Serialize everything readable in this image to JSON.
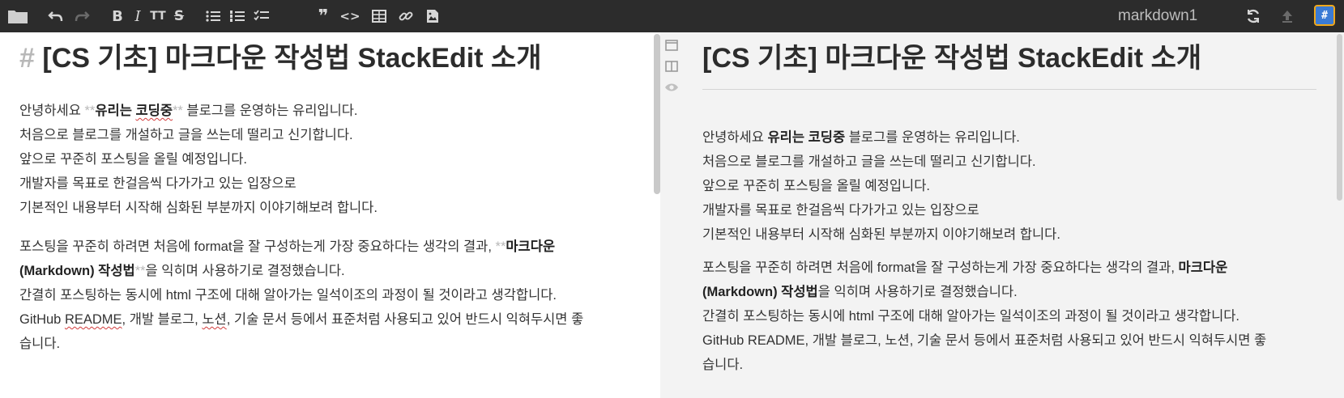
{
  "toolbar": {
    "icons": [
      "folder-icon",
      "undo-icon",
      "redo-icon",
      "bold-icon",
      "italic-icon",
      "heading-icon",
      "strikethrough-icon",
      "unordered-list-icon",
      "ordered-list-icon",
      "checklist-icon",
      "blockquote-icon",
      "code-icon",
      "table-icon",
      "link-icon",
      "image-icon",
      "sync-icon",
      "publish-icon",
      "workspace-icon"
    ],
    "bold_glyph": "B",
    "italic_glyph": "I",
    "heading_glyph": "TT",
    "strike_glyph": "S",
    "quote_glyph": "❞",
    "code_glyph": "<>",
    "document_title": "markdown1",
    "workspace_glyph": "#"
  },
  "editor": {
    "heading_mark": "#",
    "heading_text": "[CS 기초] 마크다운 작성법 StackEdit 소개",
    "p1": {
      "l1_before": "안녕하세요 ",
      "l1_mark_open": "**",
      "l1_bold_a": "유리는 ",
      "l1_bold_b": "코딩중",
      "l1_mark_close": "**",
      "l1_after": " 블로그를 운영하는 유리입니다.",
      "l2": "처음으로 블로그를 개설하고 글을 쓰는데 떨리고 신기합니다.",
      "l3": "앞으로 꾸준히 포스팅을 올릴 예정입니다.",
      "l4": "개발자를 목표로 한걸음씩 다가가고 있는 입장으로",
      "l5": "기본적인 내용부터 시작해 심화된 부분까지 이야기해보려 합니다."
    },
    "p2": {
      "a_before": "포스팅을 꾸준히 하려면 처음에 format을 잘 구성하는게 가장 중요하다는 생각의 결과, ",
      "a_mark_open": "**",
      "a_bold1": "마크다운",
      "a_bold2": "(Markdown) 작성법",
      "a_mark_close": "**",
      "a_after": "을 익히며 사용하기로 결정했습니다.",
      "b": "간결히 포스팅하는 동시에 html 구조에 대해 알아가는 일석이조의  과정이 될 것이라고 생각합니다.",
      "c_1": "GitHub ",
      "c_readme": "README",
      "c_2": ", 개발 블로그, ",
      "c_notion": "노션",
      "c_3": ", 기술 문서 등에서 표준처럼 사용되고 있어 반드시 익혀두시면 좋",
      "c_4": "습니다."
    }
  },
  "side_tools": [
    "navigation-bar-toggle-icon",
    "side-preview-toggle-icon",
    "preview-eye-icon"
  ],
  "preview": {
    "heading": "[CS 기초] 마크다운 작성법 StackEdit 소개",
    "p1": {
      "l1_before": "안녕하세요 ",
      "l1_bold": "유리는 코딩중",
      "l1_after": " 블로그를 운영하는 유리입니다.",
      "l2": "처음으로 블로그를 개설하고 글을 쓰는데 떨리고 신기합니다.",
      "l3": "앞으로 꾸준히 포스팅을 올릴 예정입니다.",
      "l4": "개발자를 목표로 한걸음씩 다가가고 있는 입장으로",
      "l5": "기본적인 내용부터 시작해 심화된 부분까지 이야기해보려 합니다."
    },
    "p2": {
      "a_before": "포스팅을 꾸준히 하려면 처음에 format을 잘 구성하는게 가장 중요하다는 생각의 결과, ",
      "a_bold1": "마크다운",
      "a_bold2": "(Markdown) 작성법",
      "a_after": "을 익히며 사용하기로 결정했습니다.",
      "b": "간결히 포스팅하는 동시에 html 구조에 대해 알아가는 일석이조의 과정이 될 것이라고 생각합니다.",
      "c": "GitHub README, 개발 블로그, 노션, 기술 문서 등에서 표준처럼 사용되고 있어 반드시 익혀두시면 좋",
      "c_2": "습니다."
    }
  },
  "colors": {
    "toolbar_bg": "#2c2c2c",
    "preview_bg": "#f3f3f3",
    "markdown_marker": "#b8b8b8",
    "spellcheck": "#d23b3b",
    "workspace_border": "#f0a81c",
    "workspace_fill": "#3a7bd5"
  }
}
